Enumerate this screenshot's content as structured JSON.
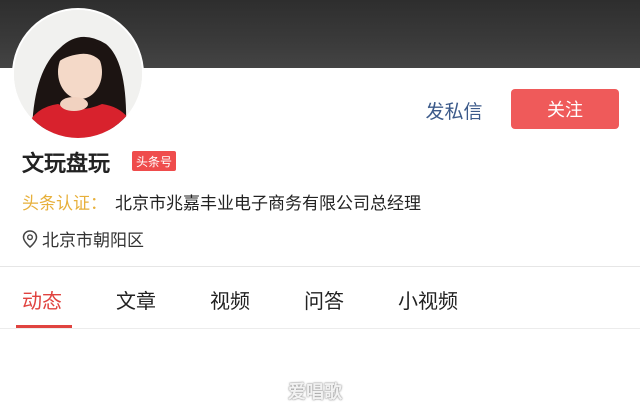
{
  "profile": {
    "name": "文玩盘玩",
    "badge": "头条号",
    "cert_label": "头条认证：",
    "cert_text": "北京市兆嘉丰业电子商务有限公司总经理",
    "location": "北京市朝阳区"
  },
  "actions": {
    "message_label": "发私信",
    "follow_label": "关注"
  },
  "tabs": [
    {
      "label": "动态",
      "active": true
    },
    {
      "label": "文章",
      "active": false
    },
    {
      "label": "视频",
      "active": false
    },
    {
      "label": "问答",
      "active": false
    },
    {
      "label": "小视频",
      "active": false
    }
  ],
  "watermark": "爱唱歌",
  "colors": {
    "accent": "#e0433f",
    "follow_button": "#ef5a5a",
    "message_link": "#3c5a8a",
    "cert_label": "#e7b03b"
  },
  "icons": {
    "location": "location-pin-icon"
  }
}
